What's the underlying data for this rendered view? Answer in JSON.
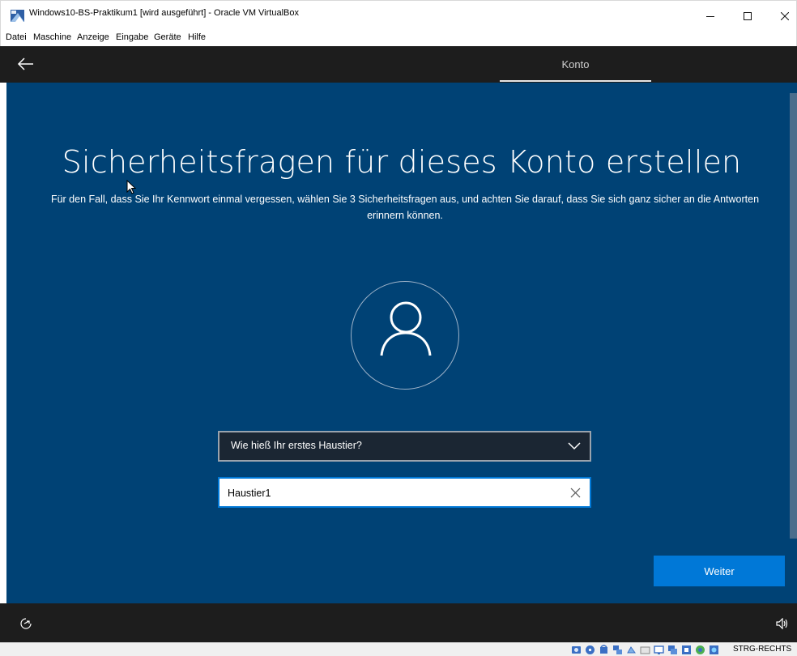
{
  "window": {
    "title": "Windows10-BS-Praktikum1 [wird ausgeführt] - Oracle VM VirtualBox",
    "icon": "virtualbox-icon",
    "controls": [
      "minimize-icon",
      "maximize-icon",
      "close-icon"
    ]
  },
  "menubar": {
    "items": [
      "Datei",
      "Maschine",
      "Anzeige",
      "Eingabe",
      "Geräte",
      "Hilfe"
    ]
  },
  "oobe": {
    "header": {
      "back_icon": "back-arrow-icon",
      "tab_label": "Konto"
    },
    "title": "Sicherheitsfragen für dieses Konto erstellen",
    "description": "Für den Fall, dass Sie Ihr Kennwort einmal vergessen, wählen Sie 3 Sicherheitsfragen aus, und achten Sie darauf, dass Sie sich ganz sicher an die Antworten erinnern können.",
    "avatar_icon": "user-icon",
    "question": {
      "selected": "Wie hieß Ihr erstes Haustier?"
    },
    "answer": {
      "value": "Haustier1"
    },
    "next_label": "Weiter",
    "footer": {
      "left_icon": "accessibility-icon",
      "right_icon": "volume-icon"
    }
  },
  "statusbar": {
    "host_key": "STRG-RECHTS",
    "icons": [
      "hard-disk-icon",
      "optical-drive-icon",
      "audio-icon",
      "network-icon",
      "usb-icon",
      "shared-folder-icon",
      "display-icon",
      "recording-icon",
      "cpu-icon",
      "mouse-integration-icon",
      "keyboard-icon"
    ]
  },
  "colors": {
    "oobe_background": "#004275",
    "oobe_bar": "#1d1d1d",
    "accent": "#0078d7",
    "select_background": "#1b2633"
  }
}
